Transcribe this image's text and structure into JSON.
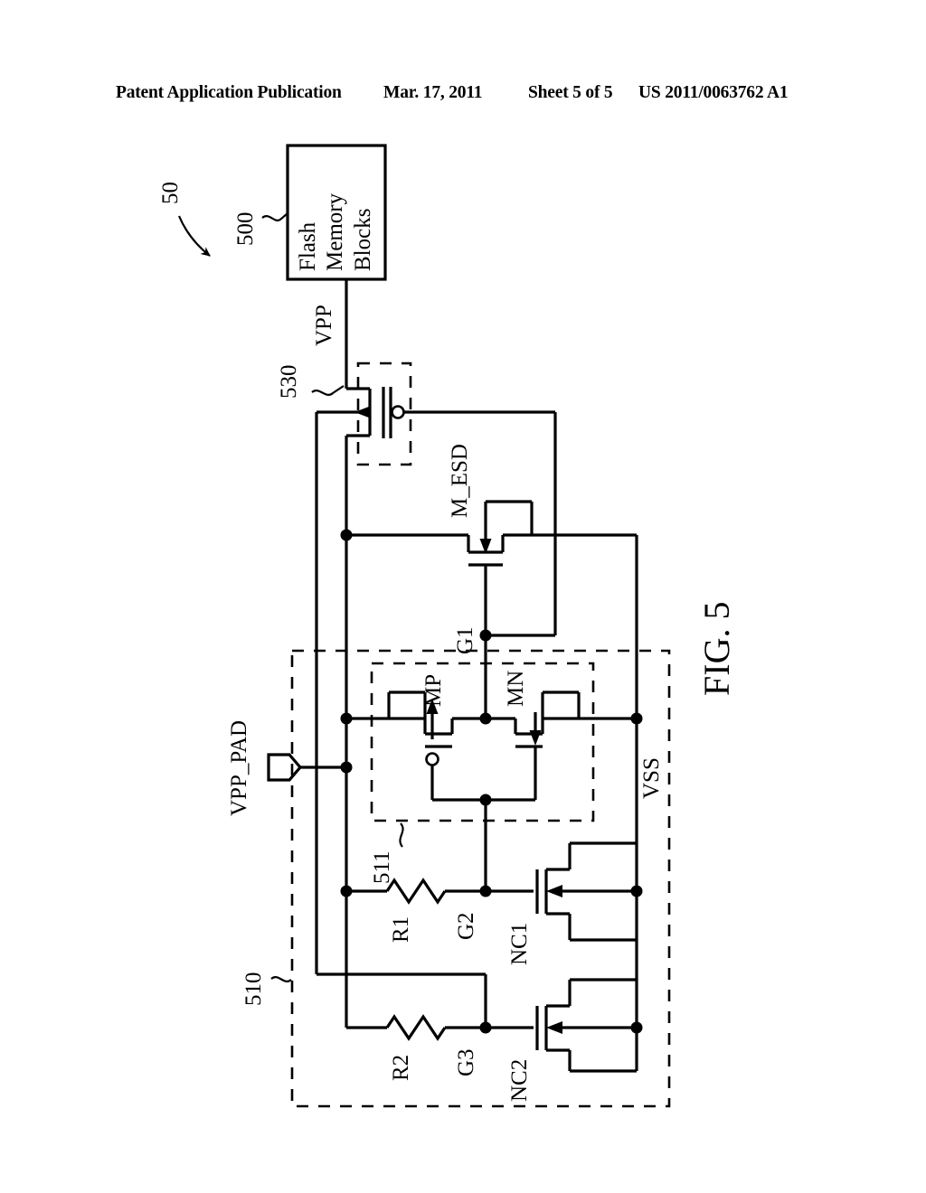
{
  "header": {
    "publication": "Patent Application Publication",
    "date": "Mar. 17, 2011",
    "sheet": "Sheet 5 of 5",
    "number": "US 2011/0063762 A1"
  },
  "figure": {
    "caption": "FIG. 5",
    "overall_ref": "50",
    "blocks": [
      {
        "ref": "500",
        "title_lines": [
          "Flash",
          "Memory",
          "Blocks"
        ]
      },
      {
        "ref": "530",
        "title_lines": []
      },
      {
        "ref": "510",
        "title_lines": []
      },
      {
        "ref": "511",
        "title_lines": []
      }
    ],
    "block_500_line1": "Flash",
    "block_500_line2": "Memory",
    "block_500_line3": "Blocks",
    "ref_500": "500",
    "ref_530": "530",
    "ref_510": "510",
    "ref_511": "511",
    "nets": {
      "vpp": "VPP",
      "vpp_pad": "VPP_PAD",
      "vss": "VSS",
      "g1": "G1",
      "g2": "G2",
      "g3": "G3"
    },
    "devices": {
      "m_esd": "M_ESD",
      "mp": "MP",
      "mn": "MN",
      "nc1": "NC1",
      "nc2": "NC2",
      "r1": "R1",
      "r2": "R2"
    }
  },
  "colors": {
    "ink": "#000000",
    "paper": "#ffffff"
  }
}
